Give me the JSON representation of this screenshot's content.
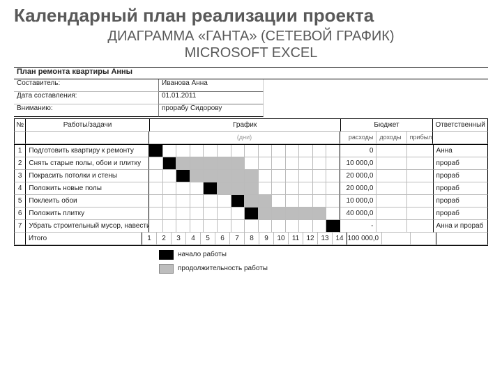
{
  "slide": {
    "title": "Календарный план реализации проекта",
    "subtitle_line1": "ДИАГРАММА «ГАНТА» (СЕТЕВОЙ ГРАФИК)",
    "subtitle_line2": "MICROSOFT EXCEL"
  },
  "meta": {
    "plan_title": "План ремонта квартиры Анны",
    "rows": [
      {
        "label": "Составитель:",
        "value": "Иванова Анна"
      },
      {
        "label": "Дата составления:",
        "value": "01.01.2011"
      },
      {
        "label": "Вниманию:",
        "value": "прорабу Сидорову"
      }
    ]
  },
  "headers": {
    "num": "№",
    "task": "Работы/задачи",
    "chart": "График",
    "budget": "Бюджет",
    "responsible": "Ответственный",
    "days_caption": "(дни)",
    "expenses": "расходы",
    "income": "доходы",
    "profit": "прибыль"
  },
  "days": [
    "1",
    "2",
    "3",
    "4",
    "5",
    "6",
    "7",
    "8",
    "9",
    "10",
    "11",
    "12",
    "13",
    "14"
  ],
  "tasks": [
    {
      "n": "1",
      "name": "Подготовить квартиру к ремонту",
      "expense": "0",
      "resp": "Анна"
    },
    {
      "n": "2",
      "name": "Снять старые полы, обои и плитку",
      "expense": "10 000,0",
      "resp": "прораб"
    },
    {
      "n": "3",
      "name": "Покрасить потолки и стены",
      "expense": "20 000,0",
      "resp": "прораб"
    },
    {
      "n": "4",
      "name": "Положить новые полы",
      "expense": "20 000,0",
      "resp": "прораб"
    },
    {
      "n": "5",
      "name": "Поклеить обои",
      "expense": "10 000,0",
      "resp": "прораб"
    },
    {
      "n": "6",
      "name": "Положить плитку",
      "expense": "40 000,0",
      "resp": "прораб"
    },
    {
      "n": "7",
      "name": "Убрать строительный мусор, навести чистоту",
      "expense": "-",
      "resp": "Анна и прораб"
    }
  ],
  "totals": {
    "label": "Итого",
    "expense": "100 000,0"
  },
  "gantt_map": {
    "1": {
      "1": "s"
    },
    "2": {
      "2": "s",
      "3": "d",
      "4": "d",
      "5": "d",
      "6": "d",
      "7": "d"
    },
    "3": {
      "3": "s",
      "4": "d",
      "5": "d",
      "6": "d",
      "7": "d",
      "8": "d"
    },
    "4": {
      "5": "s",
      "6": "d",
      "7": "d",
      "8": "d"
    },
    "5": {
      "7": "s",
      "8": "d",
      "9": "d"
    },
    "6": {
      "8": "s",
      "9": "d",
      "10": "d",
      "11": "d",
      "12": "d",
      "13": "d"
    },
    "7": {
      "14": "s"
    }
  },
  "legend": {
    "start": "начало работы",
    "duration": "продолжительность работы"
  },
  "chart_data": {
    "type": "bar",
    "orientation": "gantt",
    "title": "План ремонта квартиры Анны",
    "xlabel": "(дни)",
    "x_ticks": [
      1,
      2,
      3,
      4,
      5,
      6,
      7,
      8,
      9,
      10,
      11,
      12,
      13,
      14
    ],
    "series": [
      {
        "name": "Подготовить квартиру к ремонту",
        "start": 1,
        "duration": 1,
        "expense": 0,
        "responsible": "Анна"
      },
      {
        "name": "Снять старые полы, обои и плитку",
        "start": 2,
        "duration": 6,
        "expense": 10000,
        "responsible": "прораб"
      },
      {
        "name": "Покрасить потолки и стены",
        "start": 3,
        "duration": 6,
        "expense": 20000,
        "responsible": "прораб"
      },
      {
        "name": "Положить новые полы",
        "start": 5,
        "duration": 4,
        "expense": 20000,
        "responsible": "прораб"
      },
      {
        "name": "Поклеить обои",
        "start": 7,
        "duration": 3,
        "expense": 10000,
        "responsible": "прораб"
      },
      {
        "name": "Положить плитку",
        "start": 8,
        "duration": 6,
        "expense": 40000,
        "responsible": "прораб"
      },
      {
        "name": "Убрать строительный мусор, навести чистоту",
        "start": 14,
        "duration": 1,
        "expense": null,
        "responsible": "Анна и прораб"
      }
    ],
    "totals": {
      "expense": 100000
    },
    "legend": {
      "black": "начало работы",
      "grey": "продолжительность работы"
    }
  }
}
